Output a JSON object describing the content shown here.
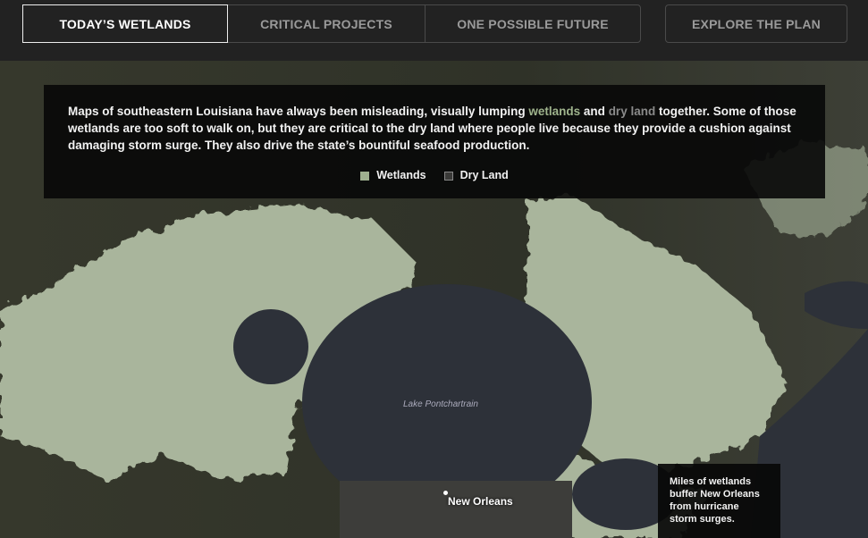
{
  "nav": {
    "tabs": [
      {
        "label": "TODAY’S WETLANDS",
        "active": true
      },
      {
        "label": "CRITICAL PROJECTS",
        "active": false
      },
      {
        "label": "ONE POSSIBLE FUTURE",
        "active": false
      }
    ],
    "explore_label": "EXPLORE THE PLAN"
  },
  "intro": {
    "t1": "Maps of southeastern Louisiana have always been misleading, visually lumping ",
    "wetlands": "wetlands",
    "t2": " and ",
    "dry_land": "dry land",
    "t3": " together. Some of those wetlands are too soft to walk on, but they are critical to the dry land where people live because they provide a cushion against damaging storm surge. They also drive the state’s bountiful seafood production.",
    "legend": [
      {
        "label": "Wetlands",
        "color": "#9fb08f"
      },
      {
        "label": "Dry Land",
        "color": "#3a3a38"
      }
    ]
  },
  "map": {
    "lake_label": "Lake Pontchartrain",
    "city_label": "New Orleans"
  },
  "callout": "Miles of wetlands buffer New Orleans from hurricane storm surges.",
  "colors": {
    "wetland": "#a9b59c",
    "dry_land": "#3b3a2e",
    "water": "#2d3139",
    "nav": "#222222"
  }
}
